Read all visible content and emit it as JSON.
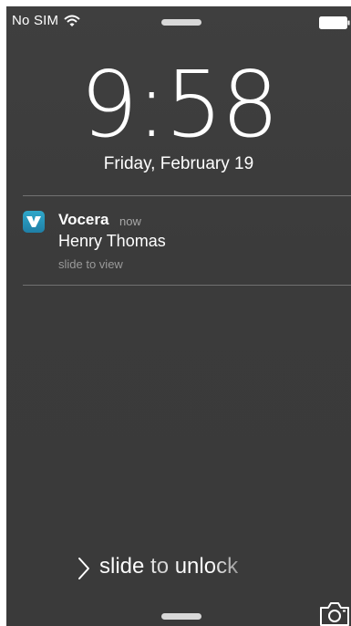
{
  "status_bar": {
    "carrier": "No SIM",
    "wifi_icon": "wifi-icon",
    "battery_icon": "battery-icon"
  },
  "lock_screen": {
    "time": "9:58",
    "date": "Friday, February 19"
  },
  "notification": {
    "app_name": "Vocera",
    "time": "now",
    "message": "Henry Thomas",
    "hint": "slide to view",
    "icon": "vocera-app-icon"
  },
  "unlock": {
    "label": "slide to unlock",
    "chevron_icon": "chevron-right-icon"
  },
  "camera": {
    "icon": "camera-icon"
  },
  "colors": {
    "background": "#3c3c3c",
    "app_icon": "#2596be",
    "secondary_text": "#a8a8a8"
  }
}
